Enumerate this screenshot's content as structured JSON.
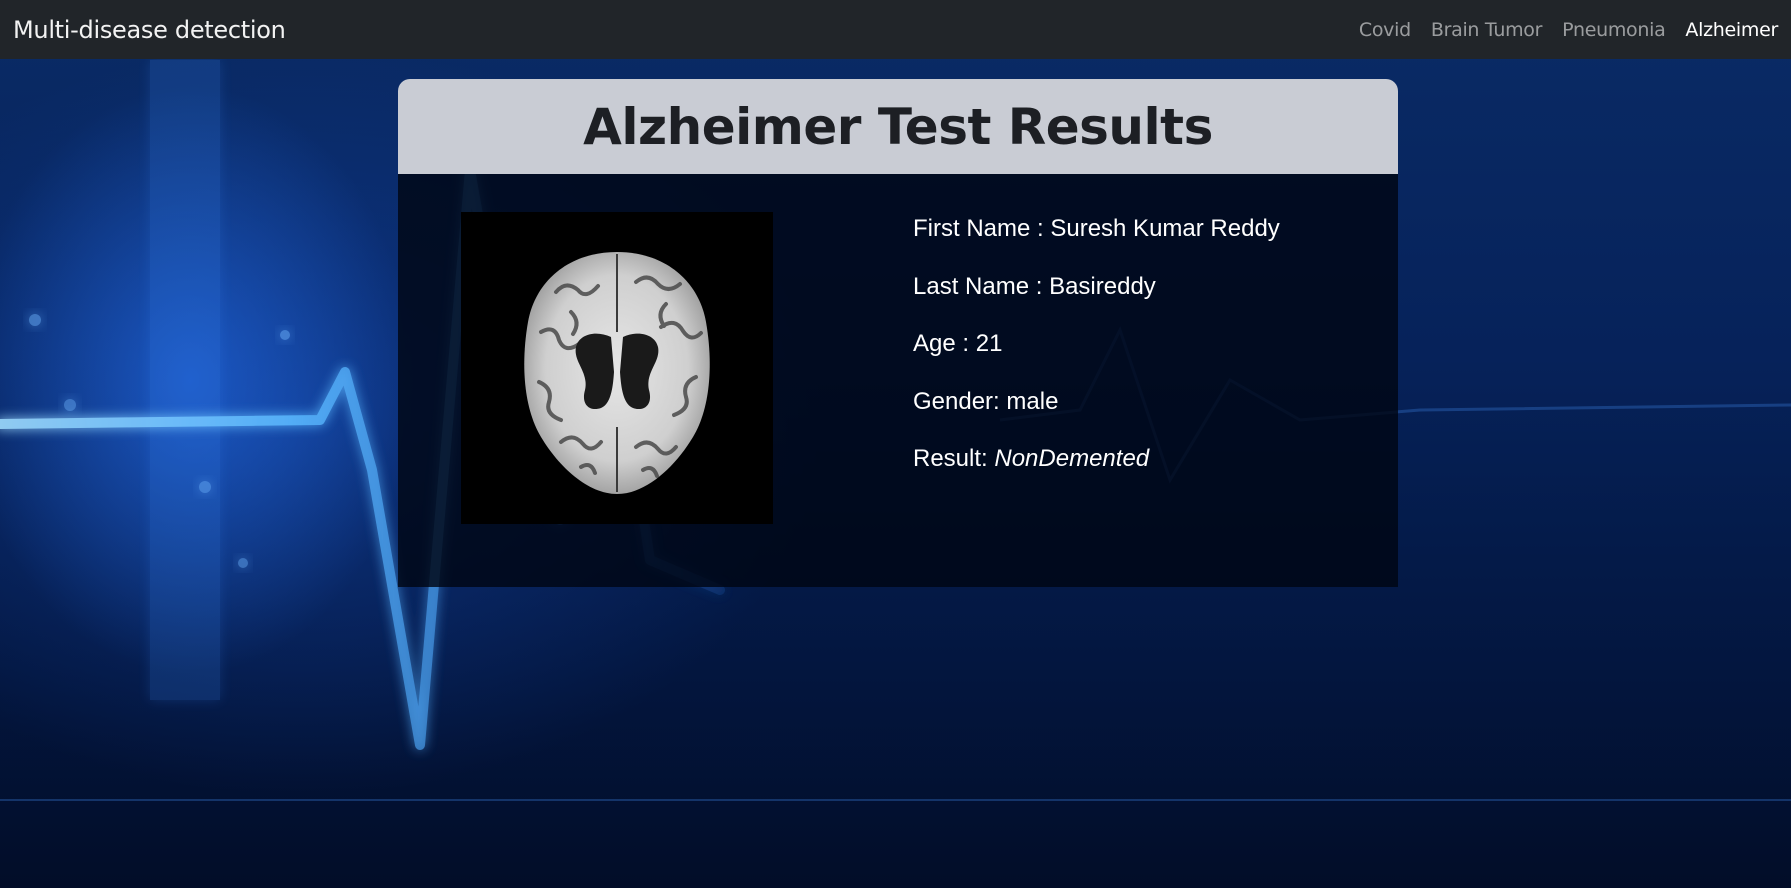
{
  "navbar": {
    "brand": "Multi-disease detection",
    "links": [
      {
        "label": "Covid",
        "active": false
      },
      {
        "label": "Brain Tumor",
        "active": false
      },
      {
        "label": "Pneumonia",
        "active": false
      },
      {
        "label": "Alzheimer",
        "active": true
      }
    ]
  },
  "card": {
    "title": "Alzheimer Test Results",
    "patient": {
      "first_name_label": "First Name : ",
      "first_name": "Suresh Kumar Reddy",
      "last_name_label": "Last Name : ",
      "last_name": "Basireddy",
      "age_label": "Age : ",
      "age": "21",
      "gender_label": "Gender: ",
      "gender": "male",
      "result_label": "Result: ",
      "result": "NonDemented"
    }
  },
  "colors": {
    "navbar_bg": "#212529",
    "card_header_bg": "#c9ccd4",
    "background_accent": "#2a8bff"
  }
}
